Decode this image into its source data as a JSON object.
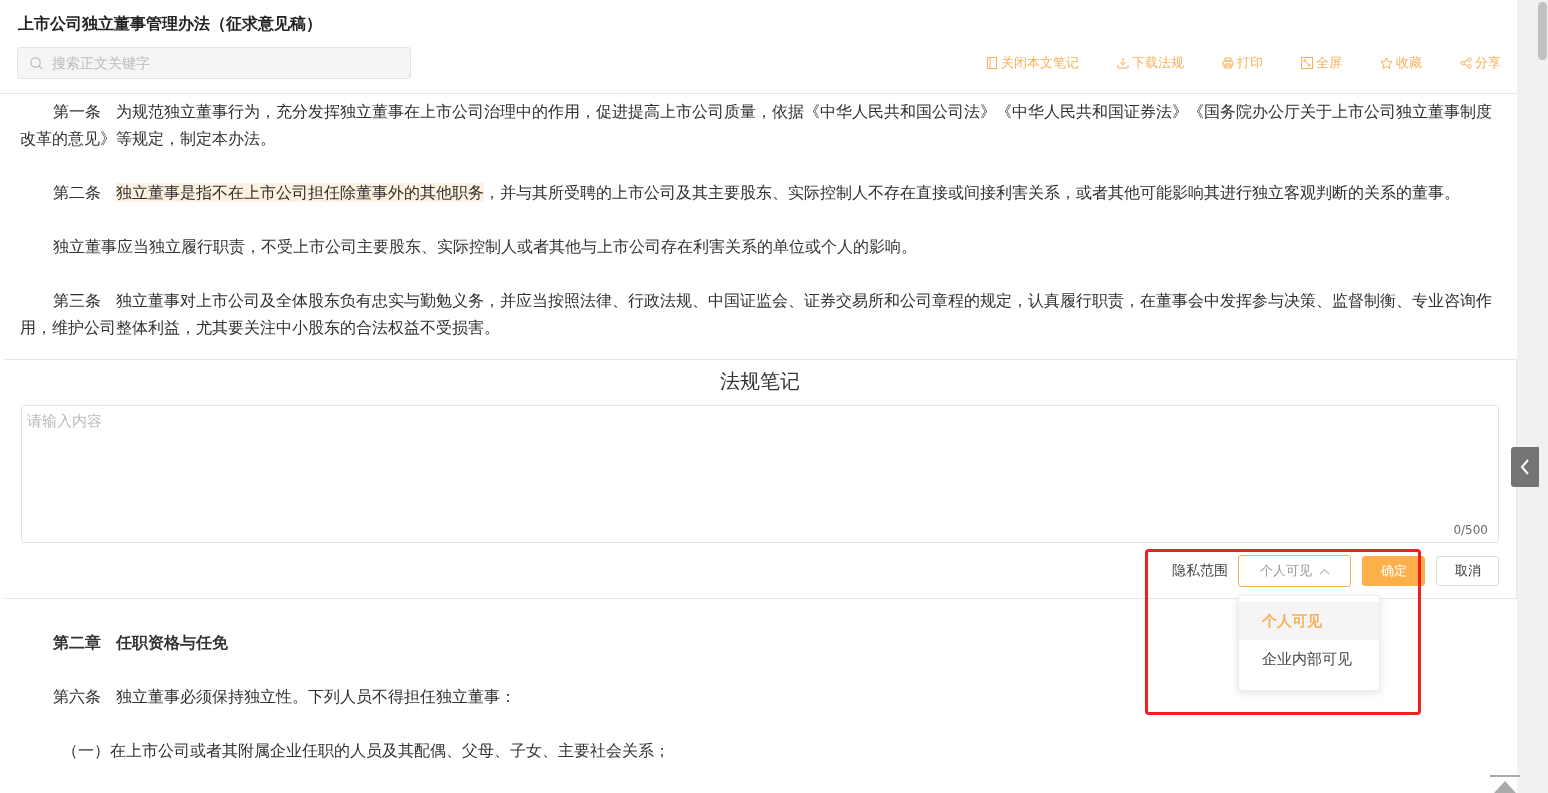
{
  "document": {
    "title": "上市公司独立董事管理办法（征求意见稿）",
    "search": {
      "placeholder": "搜索正文关键字"
    }
  },
  "toolbar": [
    {
      "kind": "note",
      "label": "关闭本文笔记"
    },
    {
      "kind": "download",
      "label": "下载法规"
    },
    {
      "kind": "print",
      "label": "打印"
    },
    {
      "kind": "fullscreen",
      "label": "全屏"
    },
    {
      "kind": "star",
      "label": "收藏"
    },
    {
      "kind": "share",
      "label": "分享"
    }
  ],
  "paragraphs_top": [
    {
      "kind": "article",
      "label": "第一条",
      "segments": [
        {
          "text": "为规范独立董事行为，充分发挥独立董事在上市公司治理中的作用，促进提高上市公司质量，依据《中华人民共和国公司法》《中华人民共和国证券法》《国务院办公厅关于上市公司独立董事制度改革的意见》等规定，制定本办法。",
          "highlighted": false
        }
      ]
    },
    {
      "kind": "article",
      "label": "第二条",
      "segments": [
        {
          "text": "独立董事是指不在上市公司担任除董事外的其他职务",
          "highlighted": true
        },
        {
          "text": "，并与其所受聘的上市公司及其主要股东、实际控制人不存在直接或间接利害关系，或者其他可能影响其进行独立客观判断的关系的董事。",
          "highlighted": false
        }
      ]
    },
    {
      "kind": "plain",
      "segments": [
        {
          "text": "独立董事应当独立履行职责，不受上市公司主要股东、实际控制人或者其他与上市公司存在利害关系的单位或个人的影响。",
          "highlighted": false
        }
      ]
    },
    {
      "kind": "article",
      "label": "第三条",
      "segments": [
        {
          "text": "独立董事对上市公司及全体股东负有忠实与勤勉义务，并应当按照法律、行政法规、中国证监会、证券交易所和公司章程的规定，认真履行职责，在董事会中发挥参与决策、监督制衡、专业咨询作用，维护公司整体利益，尤其要关注中小股东的合法权益不受损害。",
          "highlighted": false
        }
      ]
    }
  ],
  "notes_panel": {
    "title": "法规笔记",
    "input": {
      "placeholder": "请输入内容"
    },
    "counter": "0/500",
    "privacy": {
      "label": "隐私范围",
      "value": "个人可见",
      "expanded": true,
      "options": [
        {
          "label": "个人可见",
          "selected": true
        },
        {
          "label": "企业内部可见",
          "selected": false
        }
      ]
    },
    "buttons": [
      {
        "kind": "primary",
        "label": "确定"
      },
      {
        "kind": "secondary",
        "label": "取消"
      }
    ]
  },
  "paragraphs_bottom": [
    {
      "kind": "heading",
      "label": "第二章",
      "segments": [
        {
          "text": "任职资格与任免",
          "highlighted": false
        }
      ]
    },
    {
      "kind": "article",
      "label": "第六条",
      "segments": [
        {
          "text": "独立董事必须保持独立性。下列人员不得担任独立董事：",
          "highlighted": false
        }
      ]
    },
    {
      "kind": "item",
      "segments": [
        {
          "text": "（一）在上市公司或者其附属企业任职的人员及其配偶、父母、子女、主要社会关系；",
          "highlighted": false
        }
      ]
    }
  ]
}
